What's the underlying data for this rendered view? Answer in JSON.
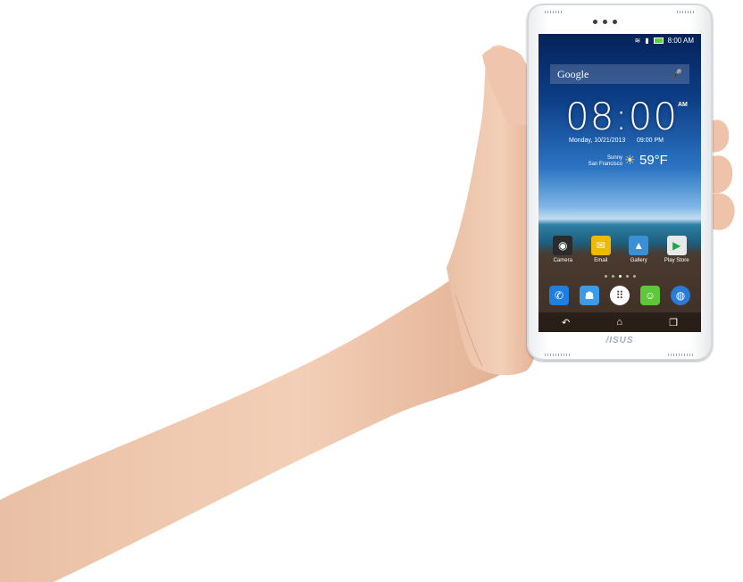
{
  "phone": {
    "brand": "/ISUS",
    "status": {
      "time": "8:00 AM",
      "wifi_icon": "wifi-icon",
      "signal_icon": "signal-icon",
      "battery_icon": "battery-icon"
    },
    "search": {
      "label": "Google",
      "mic_icon": "mic-icon"
    },
    "clock": {
      "time": "08:00",
      "ampm": "AM",
      "date": "Monday, 10/21/2013",
      "alarm": "09:00 PM"
    },
    "weather": {
      "condition": "Sunny",
      "city": "San Francisco",
      "temperature": "59°F",
      "icon": "sun-icon"
    },
    "apps": [
      {
        "label": "Camera",
        "icon": "camera-icon",
        "color": "#2b2b2b"
      },
      {
        "label": "Email",
        "icon": "email-icon",
        "color": "#f1b800"
      },
      {
        "label": "Gallery",
        "icon": "gallery-icon",
        "color": "#3b8fd6"
      },
      {
        "label": "Play Store",
        "icon": "play-store-icon",
        "color": "#e8e8e8"
      }
    ],
    "dock": [
      {
        "icon": "phone-icon",
        "color": "#1e7fe0"
      },
      {
        "icon": "contacts-icon",
        "color": "#3b9be8"
      },
      {
        "icon": "all-apps-icon",
        "color": "#ffffff"
      },
      {
        "icon": "messaging-icon",
        "color": "#5cc83a"
      },
      {
        "icon": "browser-icon",
        "color": "#2a7bd8"
      }
    ],
    "nav": {
      "back_icon": "back-icon",
      "home_icon": "home-icon",
      "recent_icon": "recent-apps-icon"
    }
  }
}
